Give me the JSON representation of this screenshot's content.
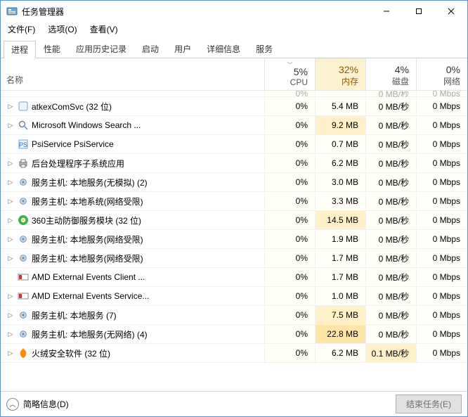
{
  "title": "任务管理器",
  "menubar": [
    "文件(F)",
    "选项(O)",
    "查看(V)"
  ],
  "tabs": [
    "进程",
    "性能",
    "应用历史记录",
    "启动",
    "用户",
    "详细信息",
    "服务"
  ],
  "active_tab": 0,
  "columns": {
    "name_label": "名称",
    "cols": [
      {
        "key": "cpu",
        "pct": "5%",
        "label": "CPU",
        "sorted": true,
        "hot": false
      },
      {
        "key": "mem",
        "pct": "32%",
        "label": "内存",
        "sorted": false,
        "hot": true
      },
      {
        "key": "disk",
        "pct": "4%",
        "label": "磁盘",
        "sorted": false,
        "hot": false
      },
      {
        "key": "net",
        "pct": "0%",
        "label": "网络",
        "sorted": false,
        "hot": false
      }
    ]
  },
  "cut_row": {
    "cpu": "0%",
    "mem": "",
    "disk": "0 MB/秒",
    "net": "0 Mbps"
  },
  "rows": [
    {
      "expand": true,
      "icon": "app",
      "name": "atkexComSvc (32 位)",
      "cpu": "0%",
      "mem": "5.4 MB",
      "disk": "0 MB/秒",
      "net": "0 Mbps"
    },
    {
      "expand": true,
      "icon": "search",
      "name": "Microsoft Windows Search ...",
      "cpu": "0%",
      "mem": "9.2 MB",
      "disk": "0 MB/秒",
      "net": "0 Mbps"
    },
    {
      "expand": false,
      "icon": "psi",
      "name": "PsiService PsiService",
      "cpu": "0%",
      "mem": "0.7 MB",
      "disk": "0 MB/秒",
      "net": "0 Mbps"
    },
    {
      "expand": true,
      "icon": "printer",
      "name": "后台处理程序子系统应用",
      "cpu": "0%",
      "mem": "6.2 MB",
      "disk": "0 MB/秒",
      "net": "0 Mbps"
    },
    {
      "expand": true,
      "icon": "gear",
      "name": "服务主机: 本地服务(无模拟) (2)",
      "cpu": "0%",
      "mem": "3.0 MB",
      "disk": "0 MB/秒",
      "net": "0 Mbps"
    },
    {
      "expand": true,
      "icon": "gear",
      "name": "服务主机: 本地系统(网络受限)",
      "cpu": "0%",
      "mem": "3.3 MB",
      "disk": "0 MB/秒",
      "net": "0 Mbps"
    },
    {
      "expand": true,
      "icon": "360",
      "name": "360主动防御服务模块 (32 位)",
      "cpu": "0%",
      "mem": "14.5 MB",
      "disk": "0 MB/秒",
      "net": "0 Mbps"
    },
    {
      "expand": true,
      "icon": "gear",
      "name": "服务主机: 本地服务(网络受限)",
      "cpu": "0%",
      "mem": "1.9 MB",
      "disk": "0 MB/秒",
      "net": "0 Mbps"
    },
    {
      "expand": true,
      "icon": "gear",
      "name": "服务主机: 本地服务(网络受限)",
      "cpu": "0%",
      "mem": "1.7 MB",
      "disk": "0 MB/秒",
      "net": "0 Mbps"
    },
    {
      "expand": false,
      "icon": "amd",
      "name": "AMD External Events Client ...",
      "cpu": "0%",
      "mem": "1.7 MB",
      "disk": "0 MB/秒",
      "net": "0 Mbps"
    },
    {
      "expand": true,
      "icon": "amd",
      "name": "AMD External Events Service...",
      "cpu": "0%",
      "mem": "1.0 MB",
      "disk": "0 MB/秒",
      "net": "0 Mbps"
    },
    {
      "expand": true,
      "icon": "gear",
      "name": "服务主机: 本地服务 (7)",
      "cpu": "0%",
      "mem": "7.5 MB",
      "disk": "0 MB/秒",
      "net": "0 Mbps"
    },
    {
      "expand": true,
      "icon": "gear",
      "name": "服务主机: 本地服务(无网络) (4)",
      "cpu": "0%",
      "mem": "22.8 MB",
      "disk": "0 MB/秒",
      "net": "0 Mbps"
    },
    {
      "expand": true,
      "icon": "huorong",
      "name": "火绒安全软件 (32 位)",
      "cpu": "0%",
      "mem": "6.2 MB",
      "disk": "0.1 MB/秒",
      "net": "0 Mbps",
      "disk_warm": true
    }
  ],
  "footer": {
    "less": "简略信息(D)",
    "end": "结束任务(E)"
  }
}
